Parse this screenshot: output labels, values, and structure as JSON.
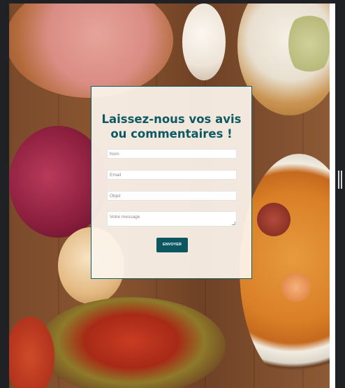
{
  "form": {
    "title_line1": "Laissez-nous vos avis",
    "title_line2": "ou commentaires !",
    "name_placeholder": "Nom",
    "email_placeholder": "Email",
    "subject_placeholder": "Objet",
    "message_placeholder": "Votre message",
    "submit_label": "ENVOYER"
  },
  "colors": {
    "accent": "#0c5662",
    "title": "#0d5963",
    "card_background": "#fcf4ec"
  },
  "icons": {
    "scroll_handle": "resize-handle-icon"
  }
}
